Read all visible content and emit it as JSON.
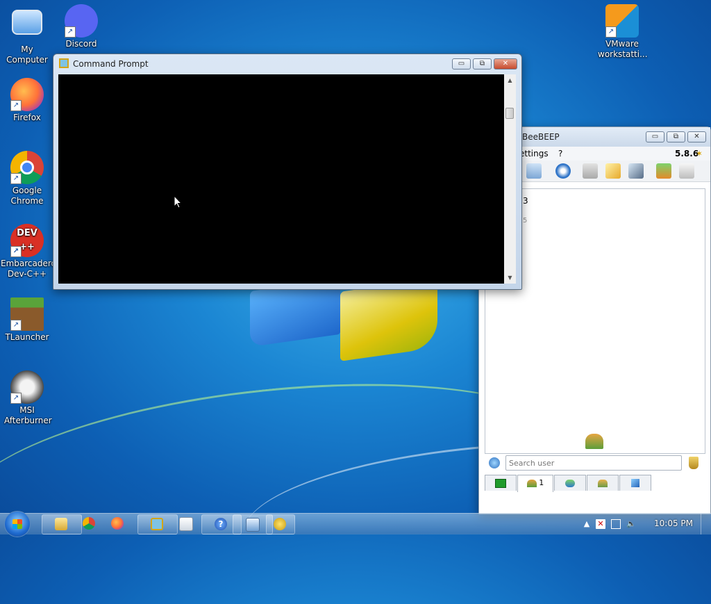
{
  "desktop": {
    "icons": [
      {
        "label": "My Computer",
        "icon": "computer-icon"
      },
      {
        "label": "Discord",
        "icon": "discord-icon"
      },
      {
        "label": "Firefox",
        "icon": "firefox-icon"
      },
      {
        "label": "Google Chrome",
        "icon": "chrome-icon"
      },
      {
        "label": "Embarcadero Dev-C++",
        "icon": "devcpp-icon",
        "glyph": "DEV\n++"
      },
      {
        "label": "TLauncher",
        "icon": "tlauncher-icon"
      },
      {
        "label": "MSI Afterburner",
        "icon": "msi-afterburner-icon"
      },
      {
        "label": "VMware workstatti...",
        "icon": "vmware-icon"
      }
    ]
  },
  "cmd": {
    "title": "Command Prompt",
    "minimize": "▭",
    "restore": "⧉",
    "close": "✕",
    "scroll_up": "▲",
    "scroll_down": "▼"
  },
  "beebeep": {
    "title": "BeeBEEP",
    "version": "5.8.6",
    "menu": {
      "settings": "ettings",
      "help": "?"
    },
    "list_line1": "3",
    "list_line2": "5",
    "search_placeholder": "Search user",
    "tabs": [
      {
        "count": ""
      },
      {
        "count": "1"
      },
      {
        "count": ""
      },
      {
        "count": ""
      },
      {
        "count": ""
      }
    ]
  },
  "taskbar": {
    "clock": "10:05 PM",
    "tray_arrow": "▲"
  },
  "colors": {
    "accent": "#1b86d3",
    "console_bg": "#000000",
    "close_red": "#c74a2d"
  }
}
